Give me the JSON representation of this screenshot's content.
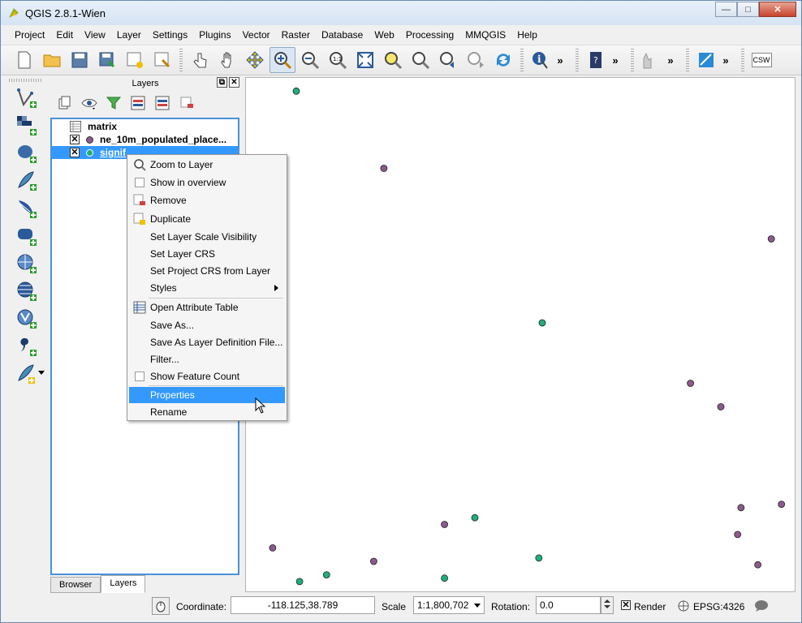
{
  "window": {
    "title": "QGIS 2.8.1-Wien",
    "minimize": "—",
    "maximize": "□",
    "close": "✕"
  },
  "menubar": [
    "Project",
    "Edit",
    "View",
    "Layer",
    "Settings",
    "Plugins",
    "Vector",
    "Raster",
    "Database",
    "Web",
    "Processing",
    "MMQGIS",
    "Help"
  ],
  "toolbar": {
    "more_glyph": "»",
    "csw_label": "CSW",
    "active_tool": "zoom-in"
  },
  "layers_panel": {
    "title": "Layers",
    "float_glyph": "⧉",
    "close_glyph": "✕",
    "layers": [
      {
        "name": "matrix",
        "type": "table",
        "checked": false
      },
      {
        "name": "ne_10m_populated_place...",
        "type": "point",
        "color": "#8b5a8b",
        "checked": true
      },
      {
        "name": "signif",
        "type": "point",
        "color": "#2eb07a",
        "checked": true,
        "selected": true
      }
    ],
    "tabs": [
      "Browser",
      "Layers"
    ],
    "active_tab": "Layers"
  },
  "context_menu": {
    "items": [
      {
        "label": "Zoom to Layer",
        "icon": "zoom-layer-icon"
      },
      {
        "label": "Show in overview",
        "icon": "checkbox"
      },
      {
        "label": "Remove",
        "icon": "remove-icon"
      },
      {
        "label": "Duplicate",
        "icon": "duplicate-icon"
      },
      {
        "label": "Set Layer Scale Visibility",
        "icon": ""
      },
      {
        "label": "Set Layer CRS",
        "icon": ""
      },
      {
        "label": "Set Project CRS from Layer",
        "icon": ""
      },
      {
        "label": "Styles",
        "icon": "",
        "submenu": true
      },
      {
        "label": "Open Attribute Table",
        "icon": "table-icon"
      },
      {
        "label": "Save As...",
        "icon": ""
      },
      {
        "label": "Save As Layer Definition File...",
        "icon": ""
      },
      {
        "label": "Filter...",
        "icon": ""
      },
      {
        "label": "Show Feature Count",
        "icon": "checkbox"
      },
      {
        "label": "Properties",
        "icon": "",
        "highlighted": true
      },
      {
        "label": "Rename",
        "icon": ""
      }
    ]
  },
  "map_points": [
    {
      "x": -118.81,
      "y": 39.63,
      "layer": "signif"
    },
    {
      "x": -118.55,
      "y": 39.4,
      "layer": "ne_10m_populated_places"
    },
    {
      "x": -117.4,
      "y": 39.19,
      "layer": "ne_10m_populated_places"
    },
    {
      "x": -118.08,
      "y": 38.94,
      "layer": "signif"
    },
    {
      "x": -117.64,
      "y": 38.76,
      "layer": "ne_10m_populated_places"
    },
    {
      "x": -117.55,
      "y": 38.69,
      "layer": "ne_10m_populated_places"
    },
    {
      "x": -117.49,
      "y": 38.39,
      "layer": "ne_10m_populated_places"
    },
    {
      "x": -117.37,
      "y": 38.4,
      "layer": "ne_10m_populated_places"
    },
    {
      "x": -118.37,
      "y": 38.34,
      "layer": "ne_10m_populated_places"
    },
    {
      "x": -118.28,
      "y": 38.36,
      "layer": "signif"
    },
    {
      "x": -117.5,
      "y": 38.31,
      "layer": "ne_10m_populated_places"
    },
    {
      "x": -118.88,
      "y": 38.27,
      "layer": "ne_10m_populated_places"
    },
    {
      "x": -118.09,
      "y": 38.24,
      "layer": "signif"
    },
    {
      "x": -118.58,
      "y": 38.23,
      "layer": "ne_10m_populated_places"
    },
    {
      "x": -117.44,
      "y": 38.22,
      "layer": "ne_10m_populated_places"
    },
    {
      "x": -118.72,
      "y": 38.19,
      "layer": "signif"
    },
    {
      "x": -118.37,
      "y": 38.18,
      "layer": "signif"
    },
    {
      "x": -118.8,
      "y": 38.17,
      "layer": "signif"
    }
  ],
  "map_extent": {
    "xmin": -118.94,
    "xmax": -117.35,
    "ymin": 38.16,
    "ymax": 39.65
  },
  "statusbar": {
    "coordinate_label": "Coordinate:",
    "coordinate_value": "-118.125,38.789",
    "scale_label": "Scale",
    "scale_value": "1:1,800,702",
    "rotation_label": "Rotation:",
    "rotation_value": "0.0",
    "render_label": "Render",
    "render_checked": true,
    "crs": "EPSG:4326"
  },
  "colors": {
    "signif": "#1fae7a",
    "populated": "#8c5a8c",
    "selection": "#3399ff"
  }
}
